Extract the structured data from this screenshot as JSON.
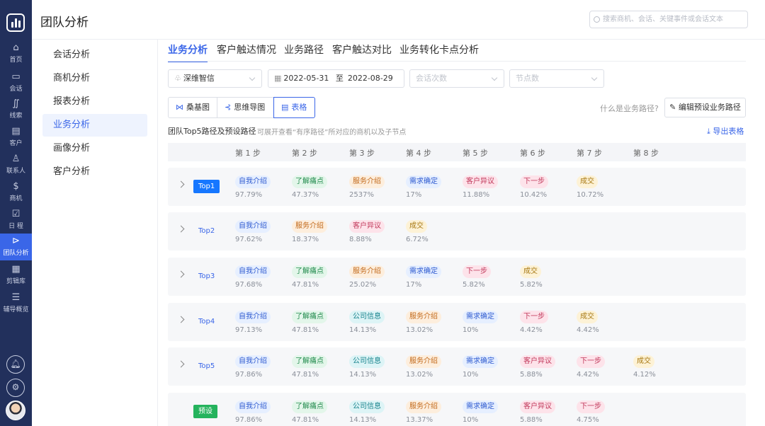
{
  "rail": {
    "items": [
      {
        "label": "首页",
        "icon": "home-icon",
        "glyph": "⌂"
      },
      {
        "label": "会话",
        "icon": "video-icon",
        "glyph": "▭"
      },
      {
        "label": "线索",
        "icon": "leads-icon",
        "glyph": "∬"
      },
      {
        "label": "客户",
        "icon": "customer-icon",
        "glyph": "▤"
      },
      {
        "label": "联系人",
        "icon": "contact-icon",
        "glyph": "♙"
      },
      {
        "label": "商机",
        "icon": "opportunity-icon",
        "glyph": "$"
      },
      {
        "label": "日 程",
        "icon": "calendar-icon",
        "glyph": "☑"
      },
      {
        "label": "团队分析",
        "icon": "team-analysis-icon",
        "glyph": "⊳"
      },
      {
        "label": "剪辑库",
        "icon": "clip-library-icon",
        "glyph": "▦"
      },
      {
        "label": "辅导概览",
        "icon": "coaching-icon",
        "glyph": "☰"
      }
    ],
    "bottom_icons": [
      "bell-icon",
      "settings-icon"
    ]
  },
  "topbar": {
    "title": "团队分析",
    "search_placeholder": "搜索商机、会话、关键事件或会话文本"
  },
  "subnav": [
    "会话分析",
    "商机分析",
    "报表分析",
    "业务分析",
    "画像分析",
    "客户分析"
  ],
  "tabs": [
    "业务分析",
    "客户触达情况",
    "业务路径",
    "客户触达对比",
    "业务转化卡点分析"
  ],
  "filters": {
    "org": "深维智信",
    "date_from": "2022-05-31",
    "date_sep": "至",
    "date_to": "2022-08-29",
    "sessions_placeholder": "会话次数",
    "nodes_placeholder": "节点数"
  },
  "views": [
    "桑基图",
    "思维导图",
    "表格"
  ],
  "help_link": "什么是业务路径?",
  "edit_button": "编辑预设业务路径",
  "section": {
    "title": "团队Top5路径及预设路径",
    "desc": "可展开查看“有序路径”所对应的商机以及子节点",
    "export": "导出表格"
  },
  "steps": [
    "第 1 步",
    "第 2 步",
    "第 3 步",
    "第 4 步",
    "第 5 步",
    "第 6 步",
    "第 7 步",
    "第 8 步"
  ],
  "rows": [
    {
      "badge": "Top1",
      "cells": [
        {
          "tag": "自我介绍",
          "pct": "97.79%",
          "color": "blue"
        },
        {
          "tag": "了解痛点",
          "pct": "47.37%",
          "color": "green"
        },
        {
          "tag": "服务介绍",
          "pct": "2537%",
          "color": "orange"
        },
        {
          "tag": "需求确定",
          "pct": "17%",
          "color": "blue"
        },
        {
          "tag": "客户异议",
          "pct": "11.88%",
          "color": "pink"
        },
        {
          "tag": "下一步",
          "pct": "10.42%",
          "color": "pink"
        },
        {
          "tag": "成交",
          "pct": "10.72%",
          "color": "yellow"
        }
      ]
    },
    {
      "badge": "Top2",
      "cells": [
        {
          "tag": "自我介绍",
          "pct": "97.62%",
          "color": "blue"
        },
        {
          "tag": "服务介绍",
          "pct": "18.37%",
          "color": "orange"
        },
        {
          "tag": "客户异议",
          "pct": "8.88%",
          "color": "pink"
        },
        {
          "tag": "成交",
          "pct": "6.72%",
          "color": "yellow"
        }
      ]
    },
    {
      "badge": "Top3",
      "cells": [
        {
          "tag": "自我介绍",
          "pct": "97.68%",
          "color": "blue"
        },
        {
          "tag": "了解痛点",
          "pct": "47.81%",
          "color": "green"
        },
        {
          "tag": "服务介绍",
          "pct": "25.02%",
          "color": "orange"
        },
        {
          "tag": "需求确定",
          "pct": "17%",
          "color": "blue"
        },
        {
          "tag": "下一步",
          "pct": "5.82%",
          "color": "pink"
        },
        {
          "tag": "成交",
          "pct": "5.82%",
          "color": "yellow"
        }
      ]
    },
    {
      "badge": "Top4",
      "cells": [
        {
          "tag": "自我介绍",
          "pct": "97.13%",
          "color": "blue"
        },
        {
          "tag": "了解痛点",
          "pct": "47.81%",
          "color": "green"
        },
        {
          "tag": "公司信息",
          "pct": "14.13%",
          "color": "cyan"
        },
        {
          "tag": "服务介绍",
          "pct": "13.02%",
          "color": "orange"
        },
        {
          "tag": "需求确定",
          "pct": "10%",
          "color": "blue"
        },
        {
          "tag": "下一步",
          "pct": "4.42%",
          "color": "pink"
        },
        {
          "tag": "成交",
          "pct": "4.42%",
          "color": "yellow"
        }
      ]
    },
    {
      "badge": "Top5",
      "cells": [
        {
          "tag": "自我介绍",
          "pct": "97.86%",
          "color": "blue"
        },
        {
          "tag": "了解痛点",
          "pct": "47.81%",
          "color": "green"
        },
        {
          "tag": "公司信息",
          "pct": "14.13%",
          "color": "cyan"
        },
        {
          "tag": "服务介绍",
          "pct": "13.02%",
          "color": "orange"
        },
        {
          "tag": "需求确定",
          "pct": "10%",
          "color": "blue"
        },
        {
          "tag": "客户异议",
          "pct": "5.88%",
          "color": "pink"
        },
        {
          "tag": "下一步",
          "pct": "4.42%",
          "color": "pink"
        },
        {
          "tag": "成交",
          "pct": "4.12%",
          "color": "yellow"
        }
      ]
    },
    {
      "badge": "预设",
      "cells": [
        {
          "tag": "自我介绍",
          "pct": "97.86%",
          "color": "blue"
        },
        {
          "tag": "了解痛点",
          "pct": "47.81%",
          "color": "green"
        },
        {
          "tag": "公司信息",
          "pct": "14.13%",
          "color": "cyan"
        },
        {
          "tag": "服务介绍",
          "pct": "13.37%",
          "color": "orange"
        },
        {
          "tag": "需求确定",
          "pct": "10%",
          "color": "blue"
        },
        {
          "tag": "客户异议",
          "pct": "5.88%",
          "color": "pink"
        },
        {
          "tag": "下一步",
          "pct": "4.75%",
          "color": "pink"
        }
      ]
    }
  ],
  "colors": {
    "accent": "#3a66e8",
    "rail": "#22305c",
    "preset": "#25b35d"
  }
}
